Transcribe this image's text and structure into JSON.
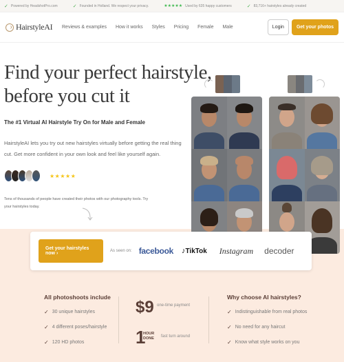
{
  "topbar": {
    "items": [
      {
        "icon": "check-icon",
        "text": "Powered by HeadshotPro.com"
      },
      {
        "icon": "check-icon",
        "text": "Founded in Holland. We respect your privacy."
      },
      {
        "icon": "stars-icon",
        "text": "Used by 635 happy customers"
      },
      {
        "icon": "check-icon",
        "text": "83,716+ hairstyles already created"
      }
    ]
  },
  "nav": {
    "logo": "HairstyleAI",
    "links": [
      "Reviews & examples",
      "How it works",
      "Styles",
      "Pricing",
      "Female",
      "Male"
    ],
    "login": "Login",
    "cta": "Get your photos"
  },
  "hero": {
    "title_line1": "Find your perfect hairstyle,",
    "title_line2": "before you cut it",
    "subtitle": "The #1 Virtual AI Hairstyle Try On for Male and Female",
    "description": "HairstyleAI lets you try out new hairstyles virtually before getting the real thing cut. Get more confident in your own look and feel like yourself again.",
    "rating_stars": "★★★★★",
    "rating": 5,
    "social_proof": "Tens of thousands of people have created their photos with our photography tools. Try your hairstyles today."
  },
  "cta_bar": {
    "button": "Get your hairstyles now  ›",
    "as_seen_on": "As seen on:",
    "logos": [
      "facebook",
      "TikTok",
      "Instagram",
      "decoder"
    ]
  },
  "features": {
    "left": {
      "title": "All photoshoots include",
      "items": [
        "30 unique hairstyles",
        "4 different poses/hairstyle",
        "120 HD photos"
      ]
    },
    "price": "$9",
    "price_label": "one-time payment",
    "turnaround_num": "1",
    "turnaround_unit1": "HOUR",
    "turnaround_unit2": "DONE",
    "turnaround_label": "fast turn around",
    "right": {
      "title": "Why choose AI hairstyles?",
      "items": [
        "Indistinguishable from real photos",
        "No need for any haircut",
        "Know what style works on you"
      ]
    }
  },
  "colors": {
    "accent": "#e0a21b",
    "brown": "#5a3e36",
    "peach": "#fcebe0"
  }
}
